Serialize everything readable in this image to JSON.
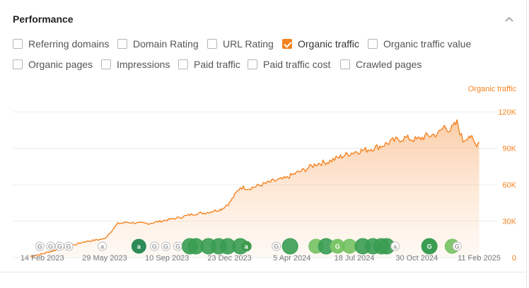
{
  "header": {
    "title": "Performance"
  },
  "filters": [
    [
      {
        "label": "Referring domains",
        "checked": false
      },
      {
        "label": "Domain Rating",
        "checked": false
      },
      {
        "label": "URL Rating",
        "checked": false
      },
      {
        "label": "Organic traffic",
        "checked": true
      },
      {
        "label": "Organic traffic value",
        "checked": false
      }
    ],
    [
      {
        "label": "Organic pages",
        "checked": false
      },
      {
        "label": "Impressions",
        "checked": false
      },
      {
        "label": "Paid traffic",
        "checked": false
      },
      {
        "label": "Paid traffic cost",
        "checked": false
      },
      {
        "label": "Crawled pages",
        "checked": false
      }
    ]
  ],
  "chart_data": {
    "type": "area",
    "series": [
      {
        "name": "Organic traffic",
        "color": "#f5821f",
        "x": [
          "2023-01-25",
          "2023-02-14",
          "2023-03-10",
          "2023-04-05",
          "2023-04-25",
          "2023-05-29",
          "2023-06-20",
          "2023-07-05",
          "2023-07-20",
          "2023-08-10",
          "2023-09-10",
          "2023-10-01",
          "2023-10-25",
          "2023-11-15",
          "2023-12-10",
          "2023-12-23",
          "2024-01-10",
          "2024-01-25",
          "2024-02-15",
          "2024-03-05",
          "2024-03-25",
          "2024-04-05",
          "2024-04-25",
          "2024-05-15",
          "2024-06-05",
          "2024-06-25",
          "2024-07-18",
          "2024-08-10",
          "2024-09-01",
          "2024-09-20",
          "2024-10-10",
          "2024-10-30",
          "2024-11-15",
          "2024-12-05",
          "2024-12-15",
          "2024-12-25",
          "2025-01-05",
          "2025-01-15",
          "2025-01-25",
          "2025-02-05",
          "2025-02-11"
        ],
        "values": [
          1000,
          3000,
          6500,
          10000,
          13000,
          15500,
          28000,
          29000,
          28500,
          28000,
          31000,
          33000,
          36000,
          37000,
          40000,
          45000,
          58000,
          57000,
          60000,
          63000,
          65000,
          68000,
          72000,
          77000,
          79000,
          83000,
          87000,
          89000,
          92000,
          96000,
          98500,
          97000,
          100000,
          102000,
          108000,
          105000,
          111000,
          96000,
          101000,
          93000,
          95000
        ]
      }
    ],
    "ylim": [
      0,
      120000
    ],
    "y_ticks": [
      "0",
      "30K",
      "60K",
      "90K",
      "120K"
    ],
    "y_tick_values": [
      0,
      30000,
      60000,
      90000,
      120000
    ],
    "x_ticks": [
      "14 Feb 2023",
      "29 May 2023",
      "10 Sep 2023",
      "23 Dec 2023",
      "5 Apr 2024",
      "18 Jul 2024",
      "30 Oct 2024",
      "11 Feb 2025"
    ],
    "x_tick_dates": [
      "2023-02-14",
      "2023-05-29",
      "2023-09-10",
      "2023-12-23",
      "2024-04-05",
      "2024-07-18",
      "2024-10-30",
      "2025-02-11"
    ],
    "y_axis_title": "Organic traffic",
    "grid": true,
    "legend": "none",
    "annotations": [
      {
        "date": "2023-02-10",
        "kind": "G"
      },
      {
        "date": "2023-02-28",
        "kind": "G"
      },
      {
        "date": "2023-03-15",
        "kind": "G"
      },
      {
        "date": "2023-03-30",
        "kind": "G"
      },
      {
        "date": "2023-05-25",
        "kind": "a"
      },
      {
        "date": "2023-07-25",
        "kind": "a-big"
      },
      {
        "date": "2023-08-20",
        "kind": "G"
      },
      {
        "date": "2023-09-08",
        "kind": "G"
      },
      {
        "date": "2023-09-28",
        "kind": "G"
      },
      {
        "date": "2023-10-18",
        "kind": "big"
      },
      {
        "date": "2023-10-28",
        "kind": "big"
      },
      {
        "date": "2023-11-18",
        "kind": "big"
      },
      {
        "date": "2023-12-05",
        "kind": "big"
      },
      {
        "date": "2023-12-20",
        "kind": "big"
      },
      {
        "date": "2024-01-10",
        "kind": "big"
      },
      {
        "date": "2024-01-20",
        "kind": "a-small"
      },
      {
        "date": "2024-03-10",
        "kind": "G"
      },
      {
        "date": "2024-04-02",
        "kind": "big"
      },
      {
        "date": "2024-05-15",
        "kind": "big-light"
      },
      {
        "date": "2024-06-01",
        "kind": "big"
      },
      {
        "date": "2024-06-20",
        "kind": "G-green"
      },
      {
        "date": "2024-07-10",
        "kind": "big-light"
      },
      {
        "date": "2024-08-01",
        "kind": "big"
      },
      {
        "date": "2024-08-18",
        "kind": "big"
      },
      {
        "date": "2024-09-01",
        "kind": "big"
      },
      {
        "date": "2024-09-10",
        "kind": "big"
      },
      {
        "date": "2024-09-24",
        "kind": "a"
      },
      {
        "date": "2024-11-20",
        "kind": "G-big"
      },
      {
        "date": "2024-12-28",
        "kind": "big-light"
      },
      {
        "date": "2025-01-05",
        "kind": "G"
      }
    ]
  }
}
